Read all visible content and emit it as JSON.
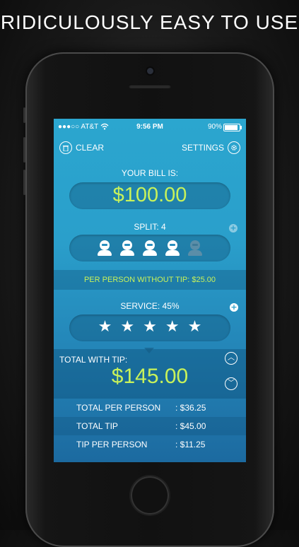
{
  "headline": "RIDICULOUSLY EASY TO USE",
  "status_bar": {
    "carrier": "●●●○○ AT&T",
    "time": "9:56 PM",
    "battery_text": "90%",
    "battery_level": 0.9
  },
  "toolbar": {
    "clear_label": "CLEAR",
    "settings_label": "SETTINGS"
  },
  "bill": {
    "label": "YOUR BILL IS:",
    "amount": "$100.00"
  },
  "split": {
    "label": "SPLIT: 4",
    "selected_count": 4,
    "total_slots": 5
  },
  "per_person_without_tip": "PER PERSON WITHOUT TIP:  $25.00",
  "service": {
    "label": "SERVICE: 45%",
    "stars": 5
  },
  "total": {
    "label": "TOTAL WITH TIP:",
    "amount": "$145.00"
  },
  "breakdown": [
    {
      "key": "TOTAL PER PERSON",
      "value": ": $36.25"
    },
    {
      "key": "TOTAL TIP",
      "value": ": $45.00"
    },
    {
      "key": "TIP PER PERSON",
      "value": ": $11.25"
    }
  ],
  "icons": {
    "trash": "trash-icon",
    "gear": "gear-icon",
    "plus": "plus-icon",
    "person": "person-icon",
    "star": "star-icon",
    "up": "chevron-up-icon",
    "down": "chevron-down-icon",
    "wifi": "wifi-icon"
  },
  "colors": {
    "accent": "#c8f25a",
    "screen_top": "#2ba6cf",
    "screen_bottom": "#1c6aa0"
  }
}
